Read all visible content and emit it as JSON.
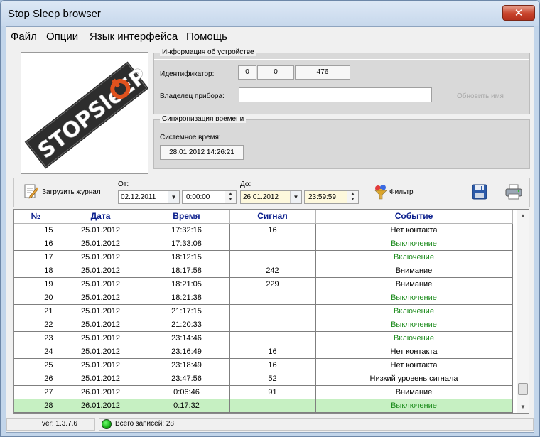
{
  "window": {
    "title": "Stop Sleep browser",
    "close_glyph": "✕"
  },
  "menu": [
    "Файл",
    "Опции",
    "Язык интерфейса",
    "Помощь"
  ],
  "logo": {
    "text": "STOPSleEP"
  },
  "device_info": {
    "title": "Информация об устройстве",
    "id_label": "Идентификатор:",
    "id_values": [
      "0",
      "0",
      "476"
    ],
    "owner_label": "Владелец прибора:",
    "owner_value": "",
    "rename_label": "Обновить имя"
  },
  "time_sync": {
    "title": "Синхронизация времени",
    "system_time_label": "Системное время:",
    "system_time_value": "28.01.2012 14:26:21"
  },
  "toolbar": {
    "load_log_label": "Загрузить журнал",
    "from_label": "От:",
    "from_date": "02.12.2011",
    "from_time": "0:00:00",
    "to_label": "До:",
    "to_date": "26.01.2012",
    "to_time": "23:59:59",
    "filter_label": "Фильтр"
  },
  "grid": {
    "columns": [
      "№",
      "Дата",
      "Время",
      "Сигнал",
      "Событие"
    ],
    "rows": [
      [
        "15",
        "25.01.2012",
        "17:32:16",
        "16",
        "Нет контакта"
      ],
      [
        "16",
        "25.01.2012",
        "17:33:08",
        "",
        "Выключение"
      ],
      [
        "17",
        "25.01.2012",
        "18:12:15",
        "",
        "Включение"
      ],
      [
        "18",
        "25.01.2012",
        "18:17:58",
        "242",
        "Внимание"
      ],
      [
        "19",
        "25.01.2012",
        "18:21:05",
        "229",
        "Внимание"
      ],
      [
        "20",
        "25.01.2012",
        "18:21:38",
        "",
        "Выключение"
      ],
      [
        "21",
        "25.01.2012",
        "21:17:15",
        "",
        "Включение"
      ],
      [
        "22",
        "25.01.2012",
        "21:20:33",
        "",
        "Выключение"
      ],
      [
        "23",
        "25.01.2012",
        "23:14:46",
        "",
        "Включение"
      ],
      [
        "24",
        "25.01.2012",
        "23:16:49",
        "16",
        "Нет контакта"
      ],
      [
        "25",
        "25.01.2012",
        "23:18:49",
        "16",
        "Нет контакта"
      ],
      [
        "26",
        "25.01.2012",
        "23:47:56",
        "52",
        "Низкий уровень сигнала"
      ],
      [
        "27",
        "26.01.2012",
        "0:06:46",
        "91",
        "Внимание"
      ],
      [
        "28",
        "26.01.2012",
        "0:17:32",
        "",
        "Выключение"
      ]
    ],
    "green_events": [
      "Выключение",
      "Включение"
    ],
    "selected_row": "28"
  },
  "status": {
    "version": "ver: 1.3.7.6",
    "total_records": "Всего записей: 28"
  },
  "colors": {
    "header_text": "#0a1e8c",
    "event_green": "#1a8a1a",
    "selected_row": "#c6f0c2",
    "status_led": "#12b312"
  }
}
